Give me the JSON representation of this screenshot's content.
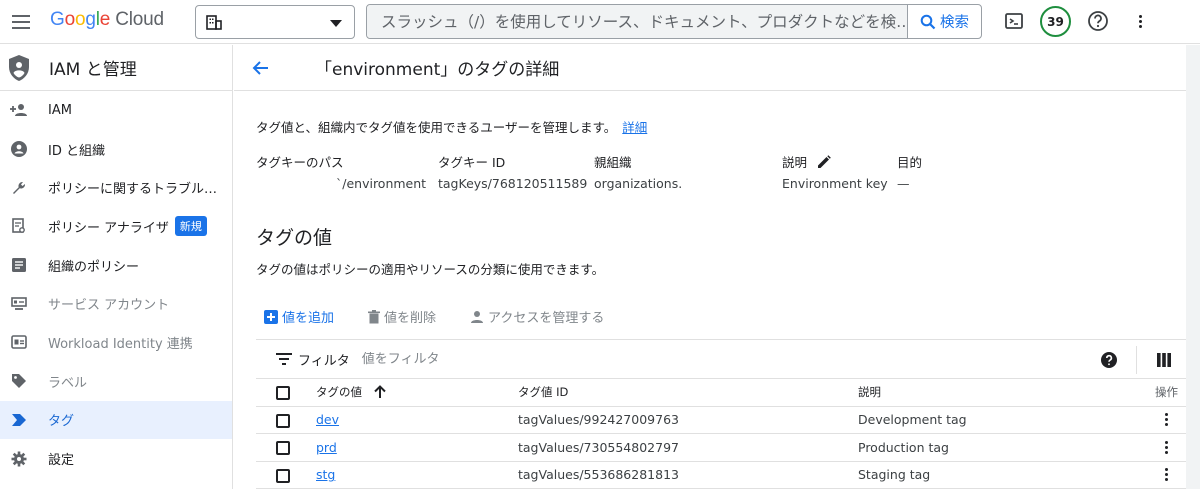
{
  "topbar": {
    "logo": {
      "g": "G",
      "o1": "o",
      "o2": "o",
      "g2": "g",
      "l": "l",
      "e": "e",
      "cloud": " Cloud"
    },
    "search_placeholder": "スラッシュ（/）を使用してリソース、ドキュメント、プロダクトなどを検…",
    "search_button": "検索",
    "notifications_count": "39"
  },
  "sidebar": {
    "title": "IAM と管理",
    "items": [
      {
        "label": "IAM",
        "icon": "person-add-icon"
      },
      {
        "label": "ID と組織",
        "icon": "account-circle-icon"
      },
      {
        "label": "ポリシーに関するトラブル…",
        "icon": "wrench-icon"
      },
      {
        "label": "ポリシー アナライザ",
        "icon": "policy-analyzer-icon",
        "badge": "新規"
      },
      {
        "label": "組織のポリシー",
        "icon": "article-icon"
      },
      {
        "label": "サービス アカウント",
        "icon": "service-account-icon"
      },
      {
        "label": "Workload Identity 連携",
        "icon": "id-card-icon"
      },
      {
        "label": "ラベル",
        "icon": "label-icon"
      },
      {
        "label": "タグ",
        "icon": "tag-icon"
      },
      {
        "label": "設定",
        "icon": "gear-icon"
      }
    ]
  },
  "main": {
    "title": "「environment」のタグの詳細",
    "description": "タグ値と、組織内でタグ値を使用できるユーザーを管理します。",
    "learn_more": "詳細",
    "details": [
      {
        "key": "タグキーのパス",
        "value": "`/environment"
      },
      {
        "key": "タグキー ID",
        "value": "tagKeys/768120511589"
      },
      {
        "key": "親組織",
        "value": "organizations."
      },
      {
        "key": "説明",
        "value": "Environment key"
      },
      {
        "key": "目的",
        "value": "—"
      }
    ],
    "section_title": "タグの値",
    "section_desc": "タグの値はポリシーの適用やリソースの分類に使用できます。",
    "actions": {
      "add": "値を追加",
      "delete": "値を削除",
      "access": "アクセスを管理する"
    },
    "filter": {
      "label": "フィルタ",
      "placeholder": "値をフィルタ"
    },
    "table": {
      "headers": {
        "value": "タグの値",
        "id": "タグ値 ID",
        "desc": "説明",
        "ops": "操作"
      },
      "rows": [
        {
          "value": "dev",
          "id": "tagValues/992427009763",
          "desc": "Development tag"
        },
        {
          "value": "prd",
          "id": "tagValues/730554802797",
          "desc": "Production tag"
        },
        {
          "value": "stg",
          "id": "tagValues/553686281813",
          "desc": "Staging tag"
        }
      ]
    }
  }
}
